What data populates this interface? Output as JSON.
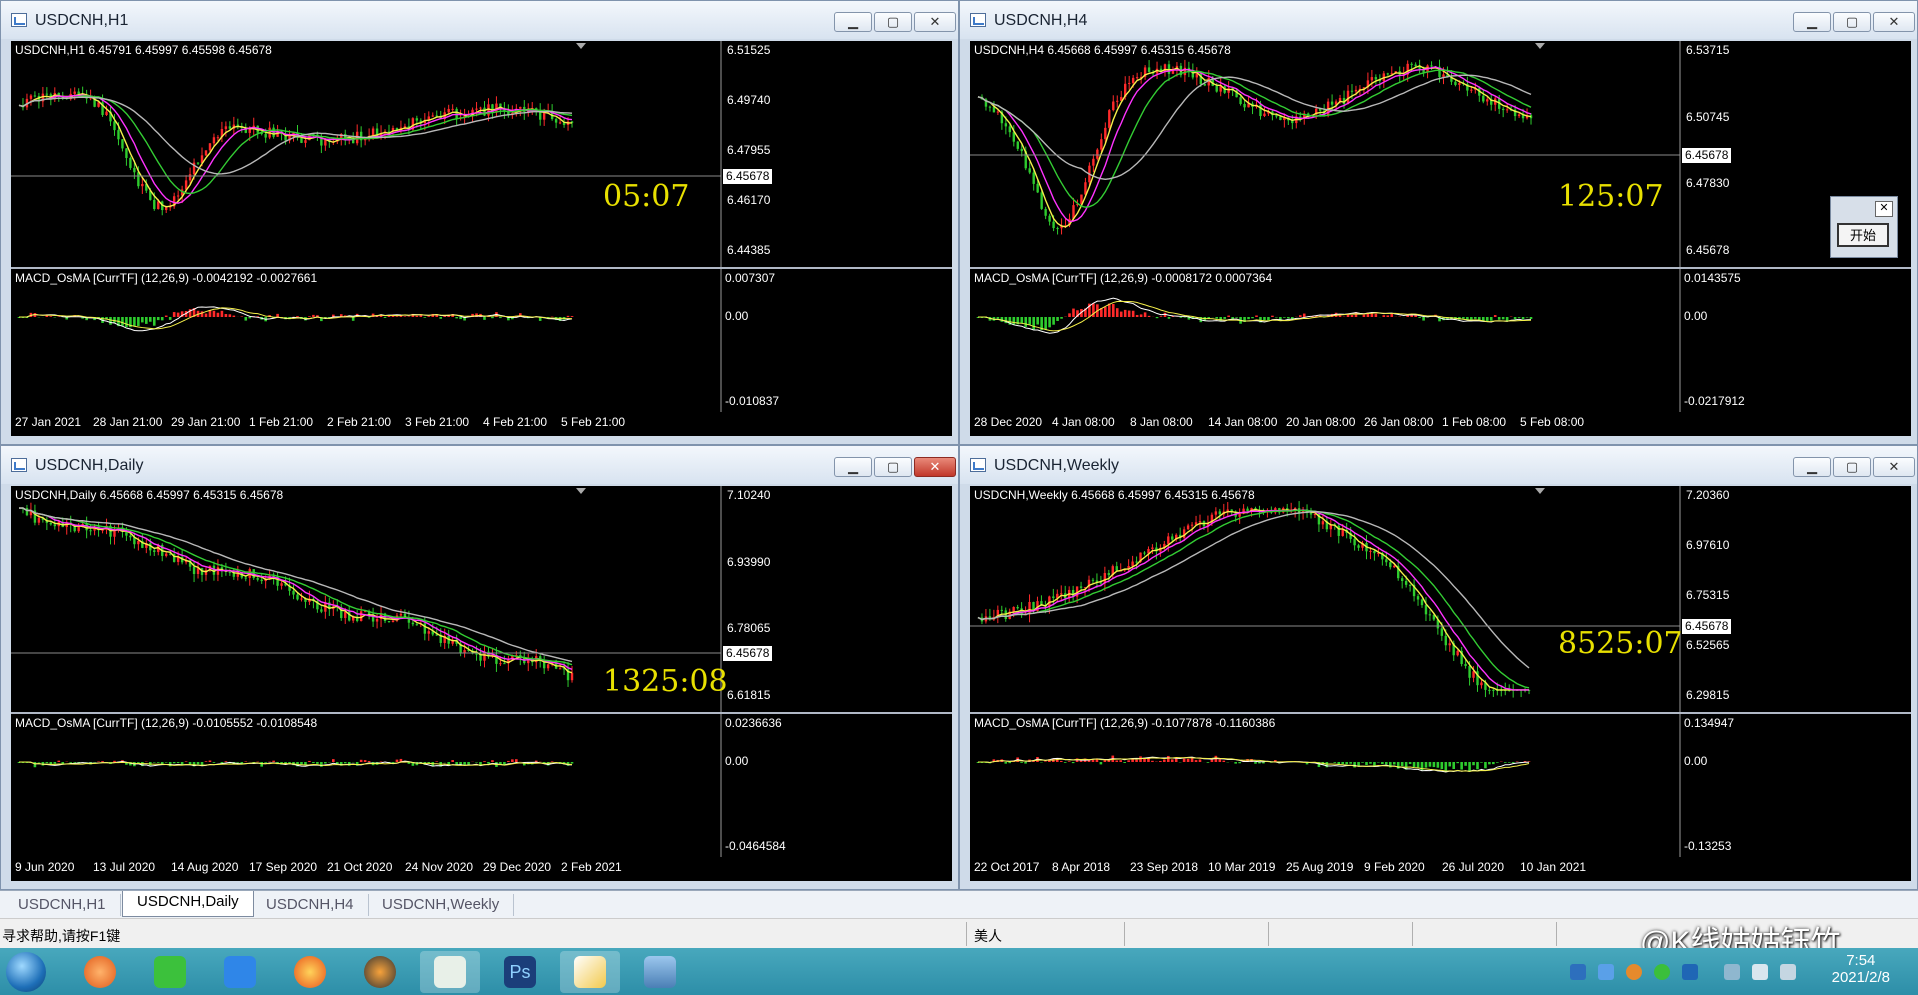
{
  "windows": [
    {
      "id": "h1",
      "title": "USDCNH,H1",
      "info": "USDCNH,H1  6.45791 6.45997 6.45598 6.45678",
      "yticks": [
        "6.51525",
        "6.49740",
        "6.47955",
        "6.46170",
        "6.44385"
      ],
      "current": "6.45678",
      "timer": "05:07",
      "macd_title": "MACD_OsMA [CurrTF] (12,26,9) -0.0042192 -0.0027661",
      "macd_ticks": [
        "0.007307",
        "0.00",
        "-0.010837"
      ],
      "dates": [
        "27 Jan 2021",
        "28 Jan 21:00",
        "29 Jan 21:00",
        "1 Feb 21:00",
        "2 Feb 21:00",
        "3 Feb 21:00",
        "4 Feb 21:00",
        "5 Feb 21:00"
      ]
    },
    {
      "id": "h4",
      "title": "USDCNH,H4",
      "info": "USDCNH,H4  6.45668 6.45997 6.45315 6.45678",
      "yticks": [
        "6.53715",
        "6.50745",
        "6.47830",
        "6.45678"
      ],
      "current": "6.45678",
      "timer": "125:07",
      "macd_title": "MACD_OsMA [CurrTF] (12,26,9) -0.0008172 0.0007364",
      "macd_ticks": [
        "0.0143575",
        "0.00",
        "-0.0217912"
      ],
      "dates": [
        "28 Dec 2020",
        "4 Jan 08:00",
        "8 Jan 08:00",
        "14 Jan 08:00",
        "20 Jan 08:00",
        "26 Jan 08:00",
        "1 Feb 08:00",
        "5 Feb 08:00"
      ]
    },
    {
      "id": "daily",
      "title": "USDCNH,Daily",
      "info": "USDCNH,Daily  6.45668 6.45997 6.45315 6.45678",
      "yticks": [
        "7.10240",
        "6.93990",
        "6.78065",
        "6.61815"
      ],
      "current": "6.45678",
      "timer": "1325:08",
      "macd_title": "MACD_OsMA [CurrTF] (12,26,9) -0.0105552 -0.0108548",
      "macd_ticks": [
        "0.0236636",
        "0.00",
        "-0.0464584"
      ],
      "dates": [
        "9 Jun 2020",
        "13 Jul 2020",
        "14 Aug 2020",
        "17 Sep 2020",
        "21 Oct 2020",
        "24 Nov 2020",
        "29 Dec 2020",
        "2 Feb 2021"
      ]
    },
    {
      "id": "weekly",
      "title": "USDCNH,Weekly",
      "info": "USDCNH,Weekly  6.45668 6.45997 6.45315 6.45678",
      "yticks": [
        "7.20360",
        "6.97610",
        "6.75315",
        "6.52565",
        "6.29815"
      ],
      "current": "6.45678",
      "timer": "8525:07",
      "macd_title": "MACD_OsMA [CurrTF] (12,26,9) -0.1077878 -0.1160386",
      "macd_ticks": [
        "0.134947",
        "0.00",
        "-0.13253"
      ],
      "dates": [
        "22 Oct 2017",
        "8 Apr 2018",
        "23 Sep 2018",
        "10 Mar 2019",
        "25 Aug 2019",
        "9 Feb 2020",
        "26 Jul 2020",
        "10 Jan 2021"
      ]
    }
  ],
  "tabs": [
    "USDCNH,H1",
    "USDCNH,Daily",
    "USDCNH,H4",
    "USDCNH,Weekly"
  ],
  "active_tab": "USDCNH,Daily",
  "status": {
    "help": "寻求帮助,请按F1键",
    "profile": "美人"
  },
  "popup": {
    "button": "开始"
  },
  "watermark": "@K线姑姑钰竹",
  "clock": {
    "time": "7:54",
    "date": "2021/2/8"
  },
  "colors": {
    "bg": "#000000",
    "bull": "#ff2a2a",
    "bear": "#2ecc2e",
    "ma_yellow": "#f5f04a",
    "ma_magenta": "#ff33ff",
    "ma_green": "#33cc33",
    "ma_gray": "#b8b8b8",
    "timer": "#e8e000"
  }
}
